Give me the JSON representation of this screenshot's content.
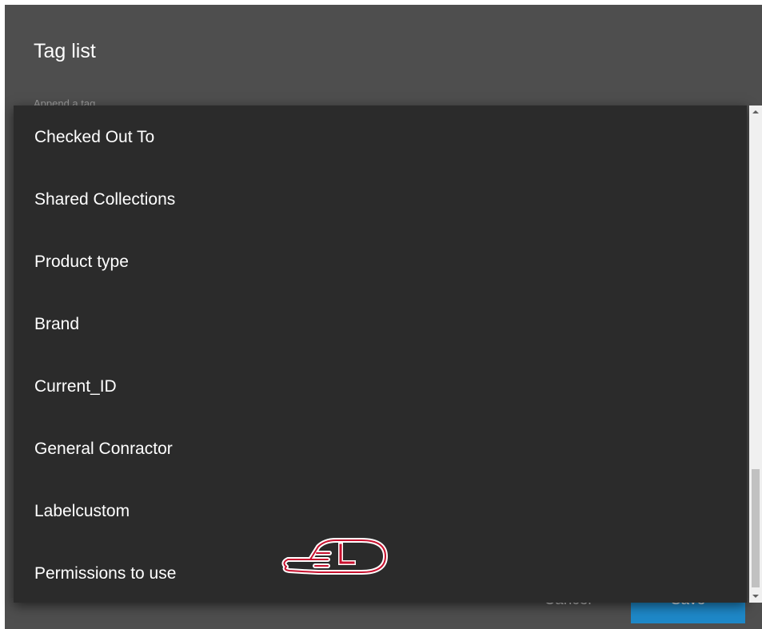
{
  "dialog": {
    "title": "Tag list",
    "append_label": "Append a tag",
    "cancel_label": "Cancel",
    "save_label": "Save"
  },
  "dropdown": {
    "options": [
      "Checked Out To",
      "Shared Collections",
      "Product type",
      "Brand",
      "Current_ID",
      "General Conractor",
      "Labelcustom",
      "Permissions to use"
    ]
  },
  "cursor": {
    "icon": "hand-pointer-icon",
    "badge": "L"
  },
  "colors": {
    "dialog_bg": "#4e4e4e",
    "dropdown_bg": "#2b2b2b",
    "save_button": "#1e88c8",
    "cursor_outline": "#c8102e"
  }
}
